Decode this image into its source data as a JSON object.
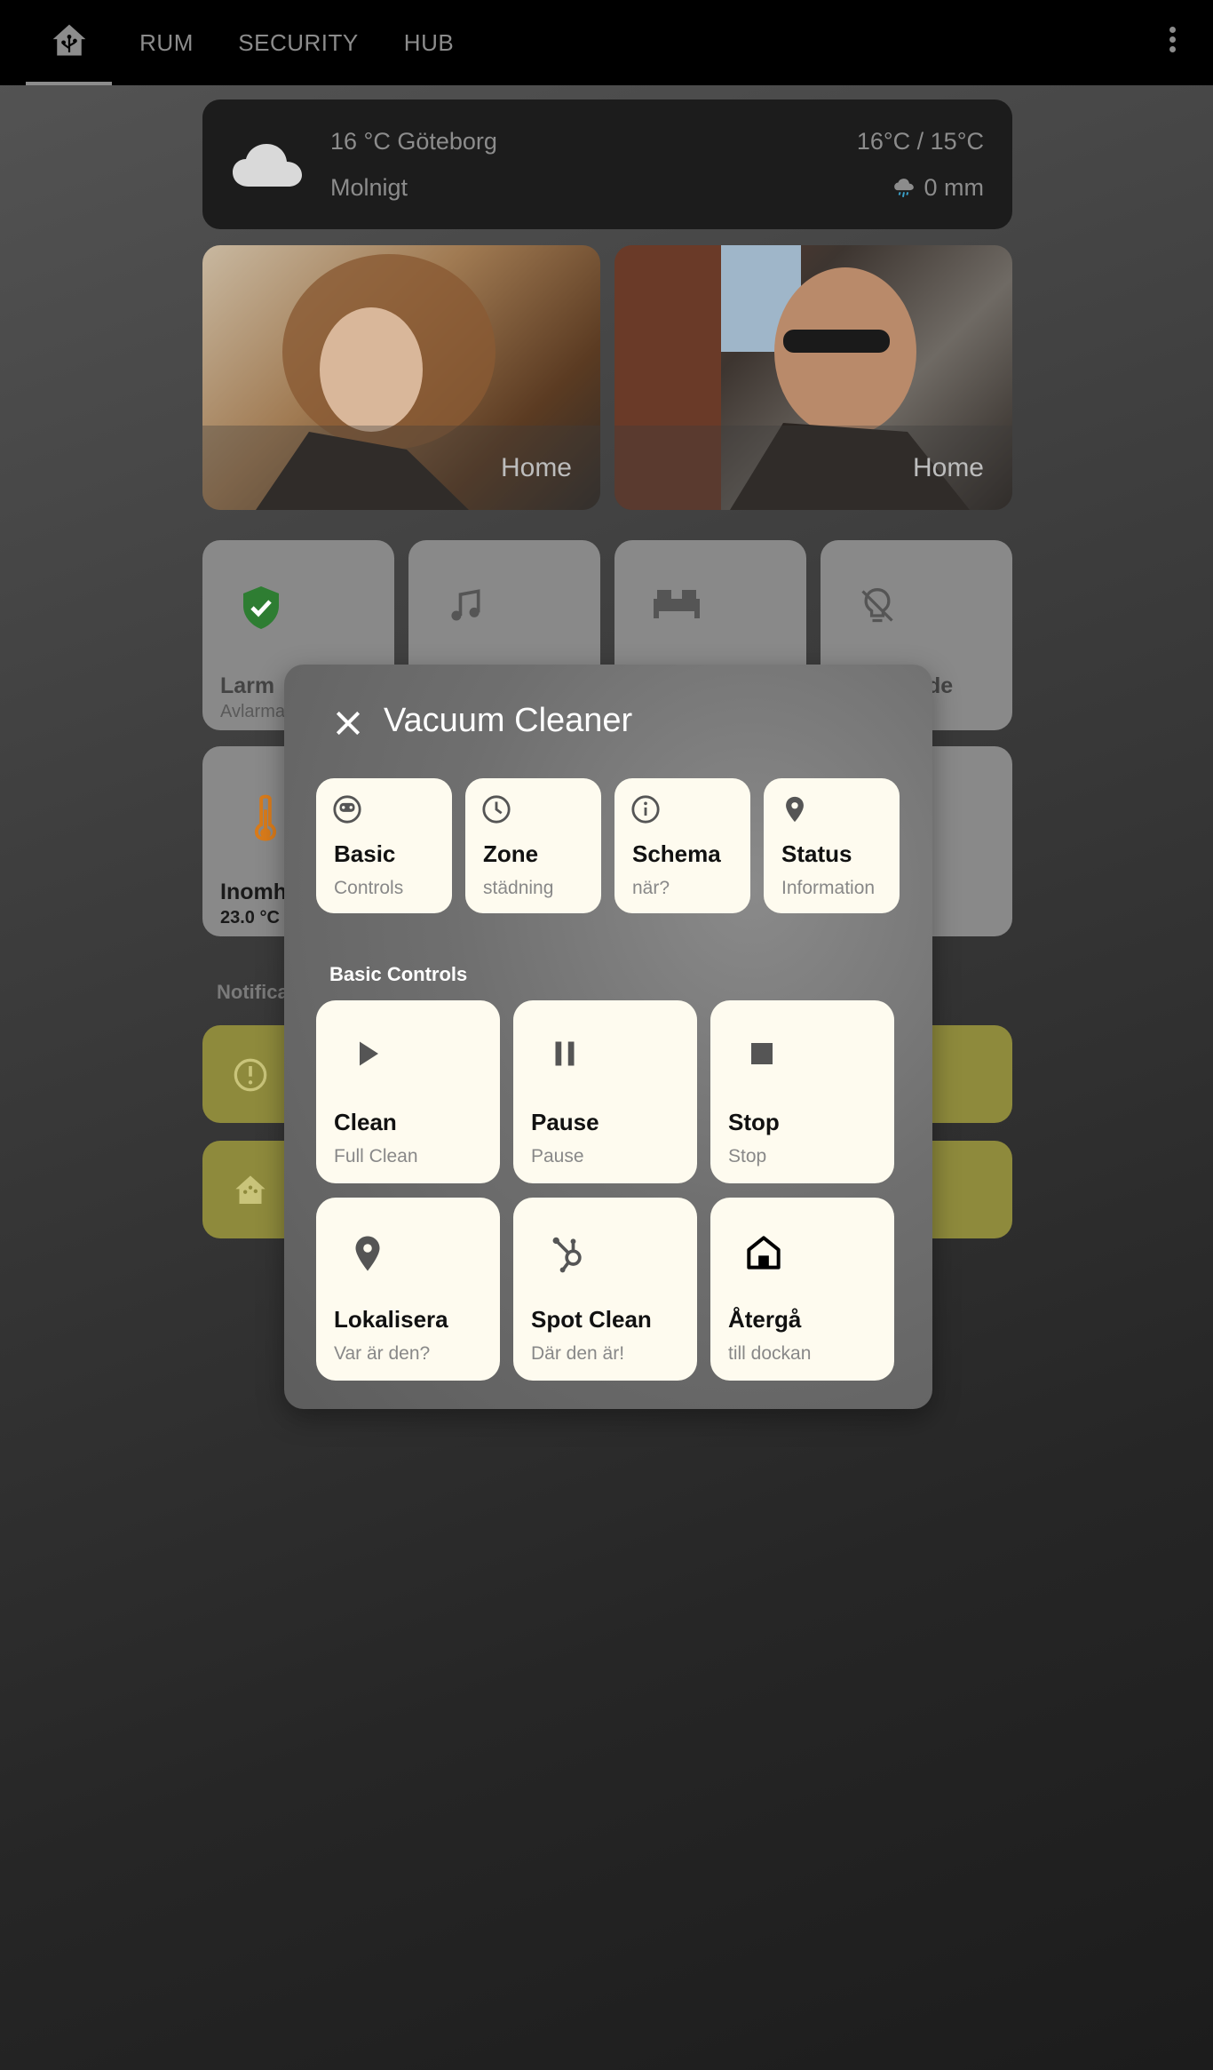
{
  "nav": {
    "tabs": [
      {
        "icon": "home-assistant-icon"
      },
      {
        "label": "RUM"
      },
      {
        "label": "SECURITY"
      },
      {
        "label": "HUB"
      }
    ],
    "menu_icon": "more-vertical-icon"
  },
  "weather": {
    "icon": "cloud-icon",
    "line1": "16 °C Göteborg",
    "condition": "Molnigt",
    "temp_range": "16°C / 15°C",
    "precipitation": "0 mm",
    "precip_icon": "rain-cloud-icon"
  },
  "persons": [
    {
      "state": "Home"
    },
    {
      "state": "Home"
    }
  ],
  "tiles": {
    "alarm_title": "Larm",
    "alarm_sub": "Avlarma",
    "lamp_title": "de",
    "temp_title": "Inomh",
    "temp_value": "23.0 °C"
  },
  "notifications": {
    "label": "Notifica"
  },
  "colors": {
    "alarm_shield": "#2e7d32",
    "thermometer": "#d97b1a",
    "notification_bg": "#8e8a3c",
    "card_bg": "#fefbef"
  },
  "dialog": {
    "title": "Vacuum Cleaner",
    "close_icon": "close-icon",
    "tabs": [
      {
        "title": "Basic",
        "subtitle": "Controls",
        "icon": "robot-vacuum-icon"
      },
      {
        "title": "Zone",
        "subtitle": "städning",
        "icon": "clock-icon"
      },
      {
        "title": "Schema",
        "subtitle": "när?",
        "icon": "info-icon"
      },
      {
        "title": "Status",
        "subtitle": "Information",
        "icon": "map-marker-icon"
      }
    ],
    "section_title": "Basic Controls",
    "controls": [
      {
        "title": "Clean",
        "subtitle": "Full Clean",
        "icon": "play-icon"
      },
      {
        "title": "Pause",
        "subtitle": "Pause",
        "icon": "pause-icon"
      },
      {
        "title": "Stop",
        "subtitle": "Stop",
        "icon": "stop-icon"
      },
      {
        "title": "Lokalisera",
        "subtitle": "Var är den?",
        "icon": "map-marker-icon"
      },
      {
        "title": "Spot Clean",
        "subtitle": "Där den är!",
        "icon": "hubspot-icon"
      },
      {
        "title": "Återgå",
        "subtitle": "till dockan",
        "icon": "home-dock-icon"
      }
    ]
  }
}
